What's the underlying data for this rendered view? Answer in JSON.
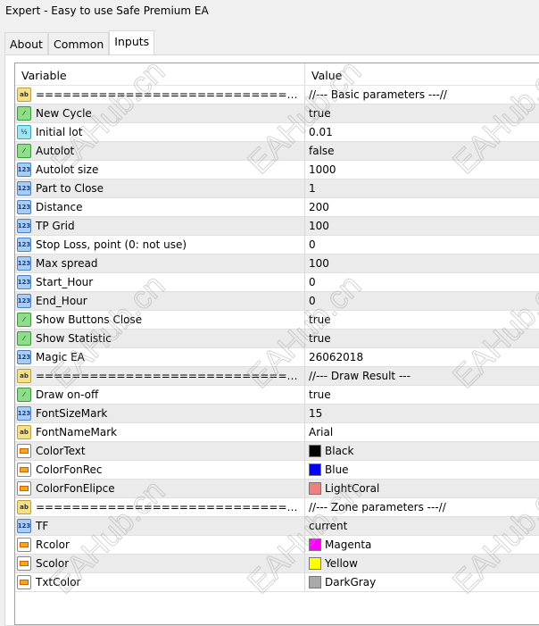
{
  "window": {
    "title": "Expert - Easy to use Safe Premium EA"
  },
  "tabs": [
    {
      "label": "About"
    },
    {
      "label": "Common"
    },
    {
      "label": "Inputs"
    }
  ],
  "table": {
    "headers": {
      "variable": "Variable",
      "value": "Value"
    },
    "rows": [
      {
        "type": "ab",
        "name": "=====================================",
        "value": "//--- Basic parameters ---//"
      },
      {
        "type": "bool",
        "name": "New Cycle",
        "value": "true"
      },
      {
        "type": "dbl",
        "name": "Initial lot",
        "value": "0.01"
      },
      {
        "type": "bool",
        "name": "Autolot",
        "value": "false"
      },
      {
        "type": "int",
        "name": "Autolot size",
        "value": "1000"
      },
      {
        "type": "int",
        "name": "Part to Close",
        "value": "1"
      },
      {
        "type": "int",
        "name": "Distance",
        "value": "200"
      },
      {
        "type": "int",
        "name": "TP Grid",
        "value": "100"
      },
      {
        "type": "int",
        "name": "Stop Loss, point (0: not use)",
        "value": "0"
      },
      {
        "type": "int",
        "name": "Max spread",
        "value": "100"
      },
      {
        "type": "int",
        "name": "Start_Hour",
        "value": "0"
      },
      {
        "type": "int",
        "name": "End_Hour",
        "value": "0"
      },
      {
        "type": "bool",
        "name": "Show Buttons Close",
        "value": "true"
      },
      {
        "type": "bool",
        "name": "Show Statistic",
        "value": "true"
      },
      {
        "type": "int",
        "name": "Magic EA",
        "value": "26062018"
      },
      {
        "type": "ab",
        "name": "=====================================",
        "value": "//--- Draw Result ---"
      },
      {
        "type": "bool",
        "name": "Draw on-off",
        "value": "true"
      },
      {
        "type": "int",
        "name": "FontSizeMark",
        "value": "15"
      },
      {
        "type": "ab",
        "name": "FontNameMark",
        "value": "Arial"
      },
      {
        "type": "col",
        "name": "ColorText",
        "value": "Black",
        "color": "#000000"
      },
      {
        "type": "col",
        "name": "ColorFonRec",
        "value": "Blue",
        "color": "#0000ff"
      },
      {
        "type": "col",
        "name": "ColorFonElipce",
        "value": "LightCoral",
        "color": "#f08080"
      },
      {
        "type": "ab",
        "name": "=====================================",
        "value": "//--- Zone parameters ---//"
      },
      {
        "type": "int",
        "name": "TF",
        "value": "current"
      },
      {
        "type": "col",
        "name": "Rcolor",
        "value": "Magenta",
        "color": "#ff00ff"
      },
      {
        "type": "col",
        "name": "Scolor",
        "value": "Yellow",
        "color": "#ffff00"
      },
      {
        "type": "col",
        "name": "TxtColor",
        "value": "DarkGray",
        "color": "#a9a9a9"
      }
    ]
  },
  "watermark": "EAHub.cn"
}
